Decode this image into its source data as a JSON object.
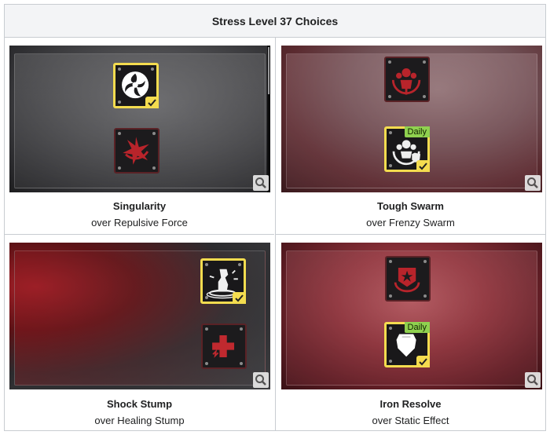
{
  "table": {
    "header": "Stress Level 37 Choices",
    "cells": [
      {
        "name": "Singularity",
        "over": "over Repulsive Force",
        "selected_badge": ""
      },
      {
        "name": "Tough Swarm",
        "over": "over Frenzy Swarm",
        "selected_badge": "Daily"
      },
      {
        "name": "Shock Stump",
        "over": "over Healing Stump",
        "selected_badge": ""
      },
      {
        "name": "Iron Resolve",
        "over": "over Static Effect",
        "selected_badge": "Daily"
      }
    ]
  },
  "colors": {
    "selected_border": "#f4dc4f",
    "daily_badge": "#8fd14f",
    "unselected_icon": "#c0292f"
  },
  "icons": {
    "singularity": "swirl-icon",
    "repulsive_force": "burst-icon",
    "tough_swarm": "swarm-shield-icon",
    "frenzy_swarm": "swarm-icon",
    "shock_stump": "stump-lightning-icon",
    "healing_stump": "cross-icon",
    "iron_resolve": "shield-icon",
    "static_effect": "star-shield-icon",
    "zoom": "magnifier-icon",
    "check": "checkmark-icon"
  }
}
